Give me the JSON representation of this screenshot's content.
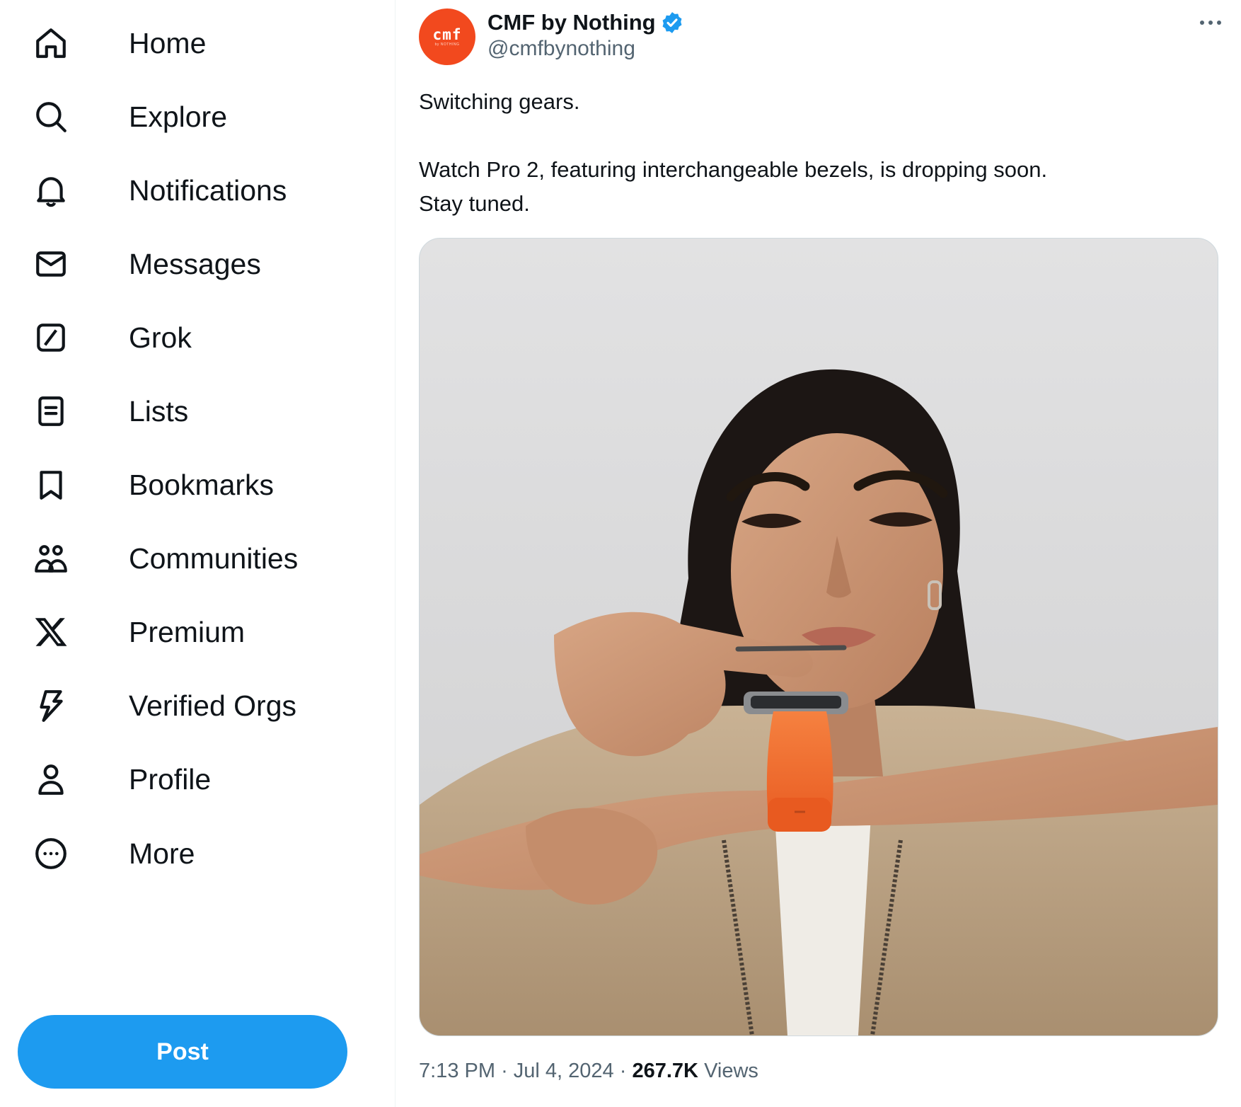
{
  "sidebar": {
    "items": [
      {
        "label": "Home",
        "icon": "home-icon"
      },
      {
        "label": "Explore",
        "icon": "search-icon"
      },
      {
        "label": "Notifications",
        "icon": "bell-icon"
      },
      {
        "label": "Messages",
        "icon": "envelope-icon"
      },
      {
        "label": "Grok",
        "icon": "grok-icon"
      },
      {
        "label": "Lists",
        "icon": "list-icon"
      },
      {
        "label": "Bookmarks",
        "icon": "bookmark-icon"
      },
      {
        "label": "Communities",
        "icon": "people-icon"
      },
      {
        "label": "Premium",
        "icon": "x-logo-icon"
      },
      {
        "label": "Verified Orgs",
        "icon": "lightning-icon"
      },
      {
        "label": "Profile",
        "icon": "person-icon"
      },
      {
        "label": "More",
        "icon": "more-circle-icon"
      }
    ],
    "post_button": "Post"
  },
  "tweet": {
    "author": {
      "name": "CMF by Nothing",
      "handle": "@cmfbynothing",
      "verified": true,
      "avatar_logo": "cmf",
      "avatar_sub": "by NOTHING"
    },
    "text_lines": [
      "Switching gears.",
      "",
      "Watch Pro 2, featuring interchangeable bezels, is dropping soon.",
      "Stay tuned."
    ],
    "meta": {
      "time": "7:13 PM",
      "separator": "·",
      "date": "Jul 4, 2024",
      "views_count": "267.7K",
      "views_label": "Views"
    }
  },
  "colors": {
    "accent": "#1d9bf0",
    "text_primary": "#0f1419",
    "text_secondary": "#536471",
    "avatar_bg": "#f2491e",
    "watch_strap": "#f06a2c"
  }
}
